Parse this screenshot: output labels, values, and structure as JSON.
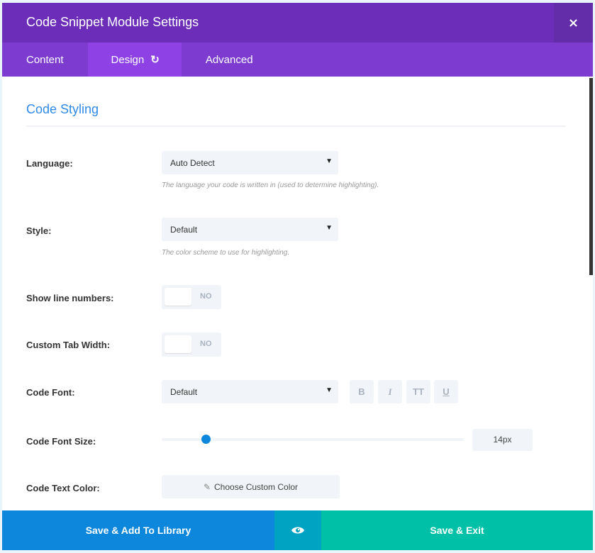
{
  "header": {
    "title": "Code Snippet Module Settings",
    "close_icon": "×"
  },
  "tabs": [
    {
      "label": "Content"
    },
    {
      "label": "Design",
      "icon": "↻"
    },
    {
      "label": "Advanced"
    }
  ],
  "section": {
    "title": "Code Styling"
  },
  "fields": {
    "language": {
      "label": "Language:",
      "value": "Auto Detect",
      "hint": "The language your code is written in (used to determine highlighting)."
    },
    "style": {
      "label": "Style:",
      "value": "Default",
      "hint": "The color scheme to use for highlighting."
    },
    "line_numbers": {
      "label": "Show line numbers:",
      "value": "NO"
    },
    "tab_width": {
      "label": "Custom Tab Width:",
      "value": "NO"
    },
    "code_font": {
      "label": "Code Font:",
      "value": "Default",
      "buttons": [
        "B",
        "I",
        "TT",
        "U"
      ]
    },
    "font_size": {
      "label": "Code Font Size:",
      "value": "14px",
      "slider_fraction": 0.145
    },
    "text_color": {
      "label": "Code Text Color:",
      "button": "Choose Custom Color"
    }
  },
  "footer": {
    "library": "Save & Add To Library",
    "exit": "Save & Exit"
  },
  "colors": {
    "header": "#6c2eb9",
    "tabs": "#7e3bd0",
    "active_tab": "#8e42e6",
    "blue": "#0c87db",
    "green": "#00c1a8"
  }
}
